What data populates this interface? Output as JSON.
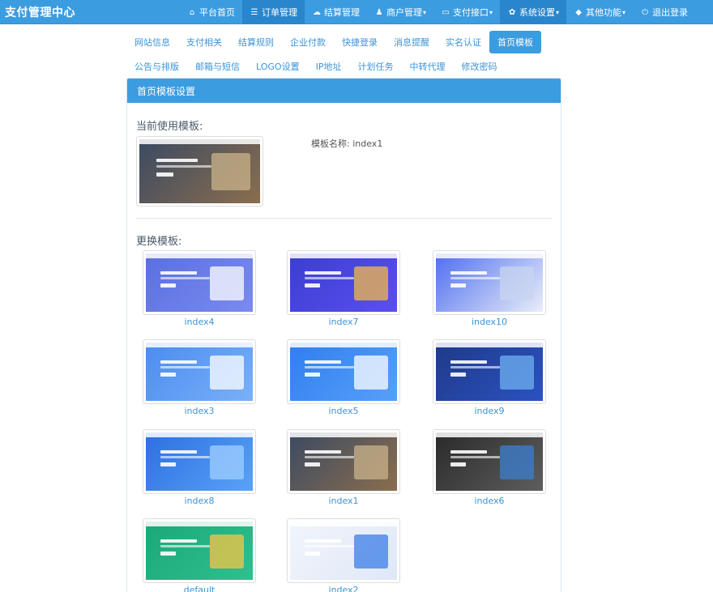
{
  "brand": "支付管理中心",
  "nav": [
    {
      "label": "平台首页",
      "icon": "home-icon",
      "glyph": "⌂",
      "caret": false,
      "active": false
    },
    {
      "label": "订单管理",
      "icon": "list-icon",
      "glyph": "☰",
      "caret": false,
      "active": true
    },
    {
      "label": "结算管理",
      "icon": "cloud-icon",
      "glyph": "☁",
      "caret": false,
      "active": false
    },
    {
      "label": "商户管理",
      "icon": "user-icon",
      "glyph": "♟",
      "caret": true,
      "active": false
    },
    {
      "label": "支付接口",
      "icon": "credit-card-icon",
      "glyph": "▭",
      "caret": true,
      "active": false
    },
    {
      "label": "系统设置",
      "icon": "gear-icon",
      "glyph": "✿",
      "caret": true,
      "active": true
    },
    {
      "label": "其他功能",
      "icon": "cube-icon",
      "glyph": "◆",
      "caret": true,
      "active": false
    },
    {
      "label": "退出登录",
      "icon": "power-icon",
      "glyph": "⏻",
      "caret": false,
      "active": false
    }
  ],
  "caret_glyph": "▾",
  "subnav_row1": [
    {
      "label": "网站信息",
      "active": false
    },
    {
      "label": "支付相关",
      "active": false
    },
    {
      "label": "结算规则",
      "active": false
    },
    {
      "label": "企业付款",
      "active": false
    },
    {
      "label": "快捷登录",
      "active": false
    },
    {
      "label": "消息提醒",
      "active": false
    },
    {
      "label": "实名认证",
      "active": false
    },
    {
      "label": "首页模板",
      "active": true
    }
  ],
  "subnav_row2": [
    {
      "label": "公告与排版",
      "active": false
    },
    {
      "label": "邮箱与短信",
      "active": false
    },
    {
      "label": "LOGO设置",
      "active": false
    },
    {
      "label": "IP地址",
      "active": false
    },
    {
      "label": "计划任务",
      "active": false
    },
    {
      "label": "中转代理",
      "active": false
    },
    {
      "label": "修改密码",
      "active": false
    }
  ],
  "panel": {
    "heading": "首页模板设置",
    "current_title": "当前使用模板:",
    "current_name_label": "模板名称:",
    "current_name": "index1",
    "change_title": "更换模板:"
  },
  "templates": [
    {
      "name": "index4",
      "bg": "#5a6fe0",
      "bg2": "#7a8bf0",
      "art": "#ffffff"
    },
    {
      "name": "index7",
      "bg": "#3a3fd0",
      "bg2": "#5b4ef0",
      "art": "#f0b84a"
    },
    {
      "name": "index10",
      "bg": "#4f6ef0",
      "bg2": "#e9eef8",
      "art": "#c8d4f0"
    },
    {
      "name": "index3",
      "bg": "#4a8cf0",
      "bg2": "#7ab0f8",
      "art": "#ffffff"
    },
    {
      "name": "index5",
      "bg": "#2f7ef0",
      "bg2": "#57a0f8",
      "art": "#ffffff"
    },
    {
      "name": "index9",
      "bg": "#1f3a8a",
      "bg2": "#2b52c0",
      "art": "#6fb0f0"
    },
    {
      "name": "index8",
      "bg": "#2c6fe0",
      "bg2": "#5aa2f8",
      "art": "#9fd0ff"
    },
    {
      "name": "index1",
      "bg": "#3b4a62",
      "bg2": "#8a6e4e",
      "art": "#c9b38a"
    },
    {
      "name": "index6",
      "bg": "#2a2a2a",
      "bg2": "#5e5e5e",
      "art": "#3c7fd0"
    },
    {
      "name": "default",
      "bg": "#1aa878",
      "bg2": "#2fc08e",
      "art": "#f5c544"
    },
    {
      "name": "index2",
      "bg": "#f2f5fb",
      "bg2": "#dfe7f7",
      "art": "#3b7ee8"
    }
  ],
  "current_thumb": {
    "bg": "#3b4a62",
    "bg2": "#8a6e4e",
    "art": "#c9b38a"
  }
}
